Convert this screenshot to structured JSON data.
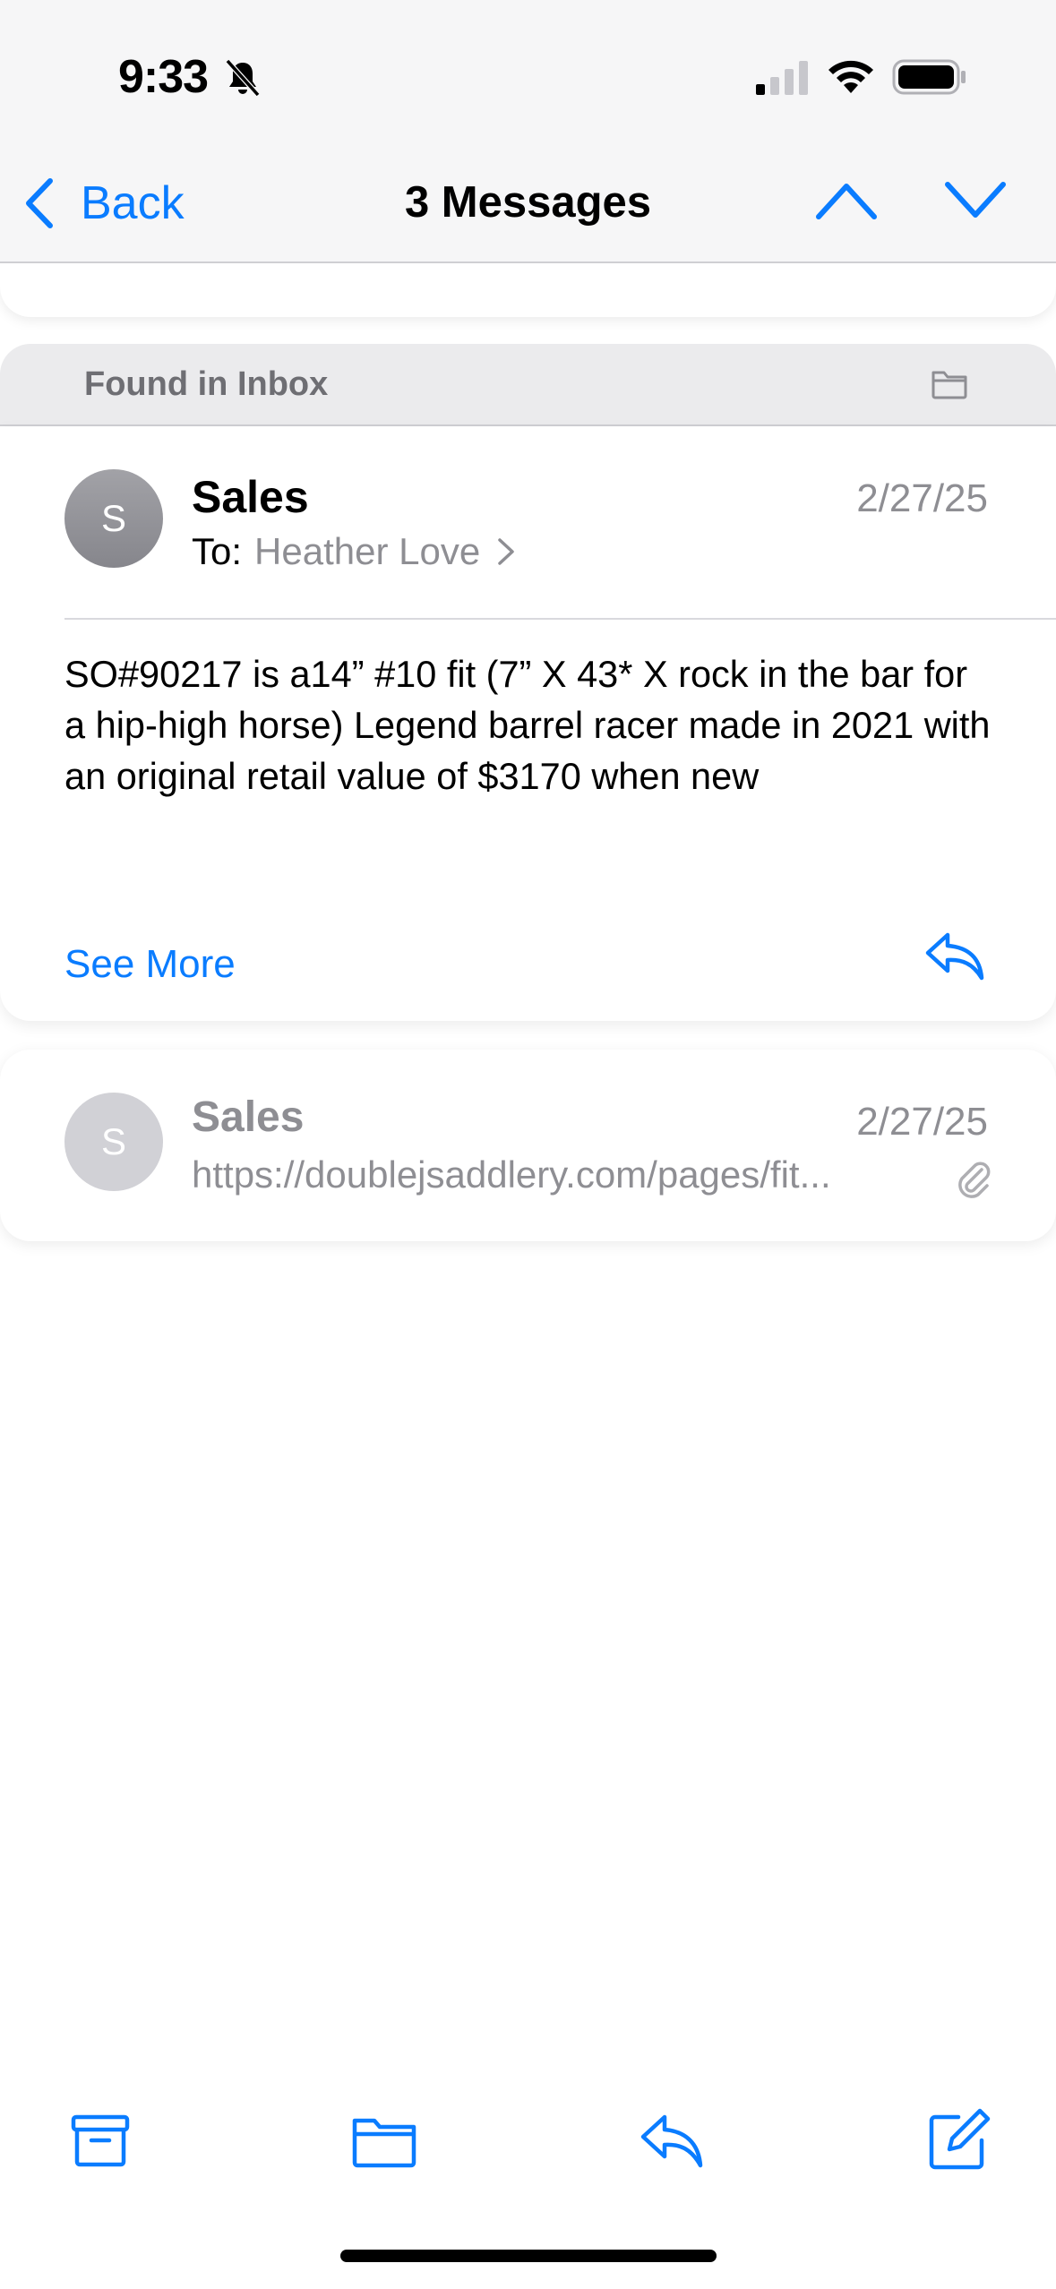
{
  "status_bar": {
    "time": "9:33",
    "icons": [
      "bell-slash-icon",
      "signal-icon",
      "wifi-icon",
      "battery-icon"
    ]
  },
  "nav": {
    "back_label": "Back",
    "title": "3 Messages"
  },
  "found_in": {
    "label": "Found in Inbox"
  },
  "message_main": {
    "avatar_letter": "S",
    "sender": "Sales",
    "date": "2/27/25",
    "to_label": "To:",
    "to_name": "Heather Love",
    "body": "SO#90217 is a14” #10 fit (7” X 43* X rock in the bar for a hip-high horse) Legend barrel racer made in 2021 with an original retail value of $3170 when new",
    "see_more": "See More"
  },
  "message_second": {
    "avatar_letter": "S",
    "sender": "Sales",
    "date": "2/27/25",
    "preview": "https://doublejsaddlery.com/pages/fit..."
  },
  "colors": {
    "accent": "#0a7cff",
    "secondary_text": "#8e8e93",
    "header_bg": "#f6f6f7"
  },
  "toolbar_icons": [
    "archive-icon",
    "folder-icon",
    "reply-icon",
    "compose-icon"
  ]
}
